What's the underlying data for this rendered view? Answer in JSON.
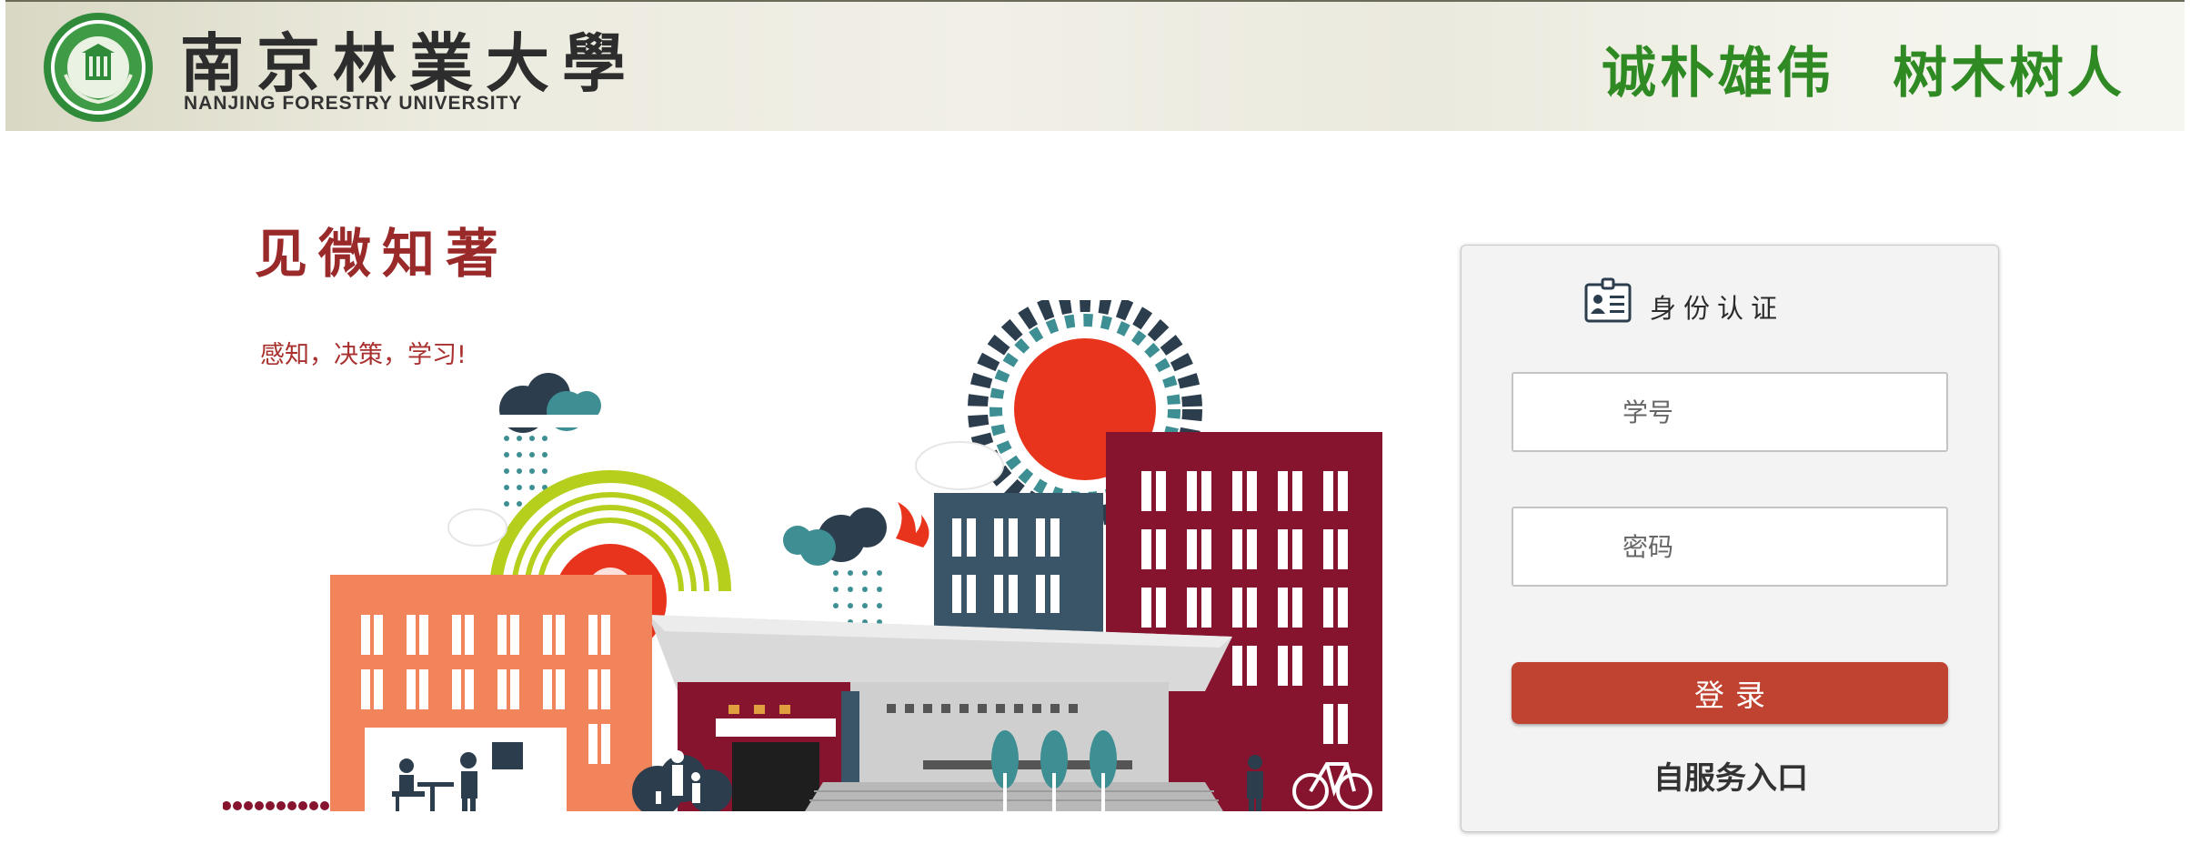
{
  "header": {
    "university_cn": "南京林業大學",
    "university_en": "NANJING FORESTRY UNIVERSITY",
    "motto": "诚朴雄伟　树木树人"
  },
  "hero": {
    "title": "见微知著",
    "subtitle": "感知，决策，学习!"
  },
  "login": {
    "title": "身份认证",
    "username_placeholder": "学号",
    "username_value": "",
    "password_placeholder": "密码",
    "password_value": "",
    "submit_label": "登录",
    "self_service_label": "自服务入口"
  },
  "colors": {
    "brand_green": "#2f8a24",
    "accent_red": "#9a2a2a",
    "button": "#bf4330"
  },
  "icons": {
    "emblem": "university-emblem-icon",
    "id_card": "id-card-icon"
  }
}
